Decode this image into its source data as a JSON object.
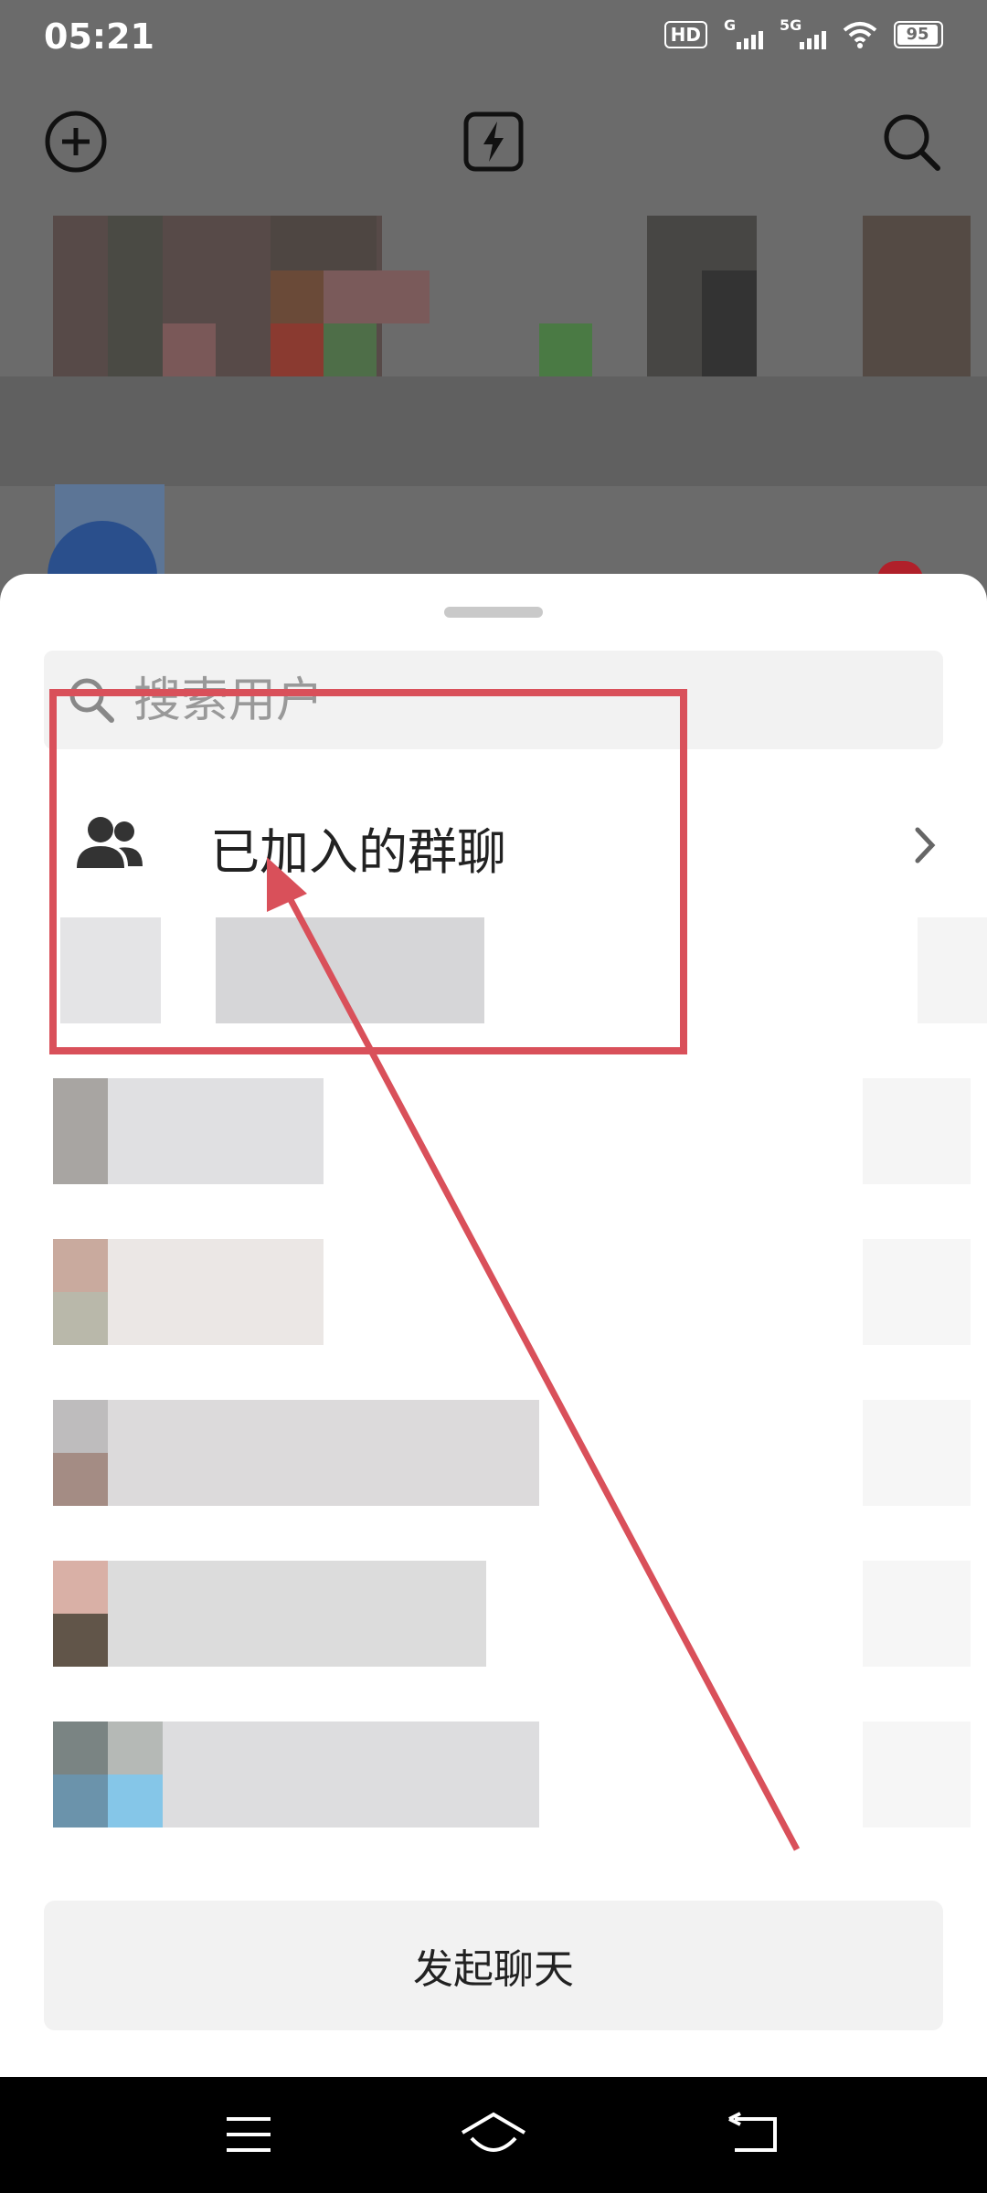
{
  "status_bar": {
    "time": "05:21",
    "hd_label": "HD",
    "network_1": "G",
    "network_2": "5G",
    "battery": "95"
  },
  "search": {
    "placeholder": "搜索用户"
  },
  "joined_groups": {
    "label": "已加入的群聊"
  },
  "start_chat_button": {
    "label": "发起聊天"
  },
  "colors": {
    "annotation_red": "#d9505a",
    "sheet_background": "#ffffff",
    "dim_overlay": "#6b6b6b"
  },
  "icons": {
    "add": "plus-circle-icon",
    "quick": "lightning-icon",
    "search": "search-icon",
    "group": "people-icon",
    "chevron": "chevron-right-icon"
  }
}
